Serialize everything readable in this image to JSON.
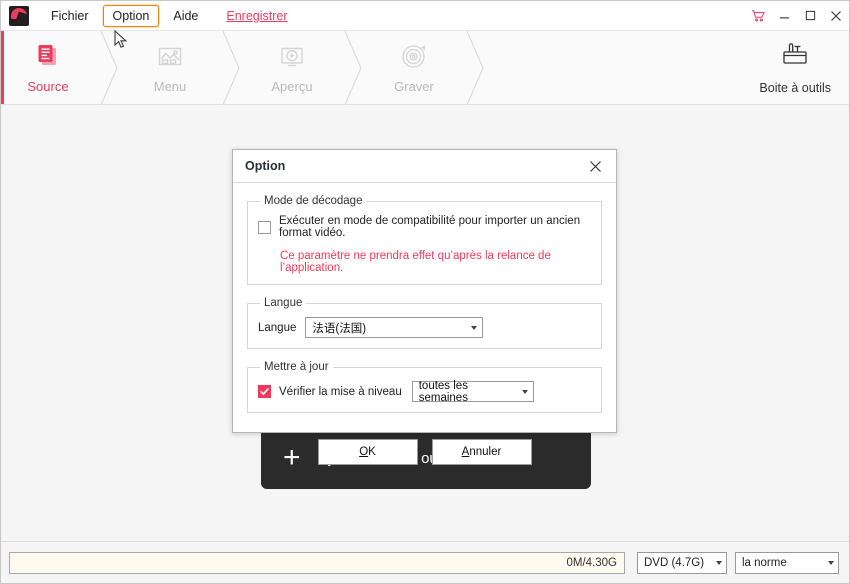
{
  "window": {
    "logo_icon": "app-logo-icon",
    "menus": [
      {
        "label": "Fichier",
        "highlighted": false
      },
      {
        "label": "Option",
        "highlighted": true
      },
      {
        "label": "Aide",
        "highlighted": false
      }
    ],
    "register_link": "Enregistrer",
    "controls": {
      "cart_icon": "shopping-cart-icon",
      "minimize_icon": "minimize-icon",
      "maximize_icon": "maximize-icon",
      "close_icon": "close-icon"
    }
  },
  "steps": {
    "accent_color": "#ee3a5c",
    "items": [
      {
        "label": "Source",
        "icon": "source-document-icon",
        "active": true
      },
      {
        "label": "Menu",
        "icon": "menu-image-icon",
        "active": false
      },
      {
        "label": "Aperçu",
        "icon": "preview-play-icon",
        "active": false
      },
      {
        "label": "Graver",
        "icon": "burn-disc-icon",
        "active": false
      }
    ],
    "toolbox": {
      "label": "Boite à outils",
      "icon": "toolbox-icon"
    }
  },
  "main": {
    "add_media": {
      "label": "Ajouter Photos ou Vidéos",
      "plus_icon": "plus-icon"
    }
  },
  "dialog": {
    "title": "Option",
    "close_icon": "close-icon",
    "decoding": {
      "legend": "Mode de décodage",
      "checkbox_label": "Exécuter en mode de compatibilité pour importer un ancien format vidéo.",
      "checked": false,
      "note": "Ce paramètre ne prendra effet qu’après la relance de l’application.",
      "note_color": "#ee3a5c"
    },
    "language": {
      "legend": "Langue",
      "field_label": "Langue",
      "value": "法语(法国)",
      "arrow_icon": "chevron-down-icon"
    },
    "update": {
      "legend": "Mettre à jour",
      "checkbox_label": "Vérifier la mise à niveau",
      "checked": true,
      "check_color": "#ee3a5c",
      "frequency_value": "toutes les semaines",
      "arrow_icon": "chevron-down-icon"
    },
    "buttons": {
      "ok_prefix": "",
      "ok_mnemonic": "O",
      "ok_suffix": "K",
      "cancel_mnemonic": "A",
      "cancel_suffix": "nnuler"
    }
  },
  "statusbar": {
    "progress_text": "0M/4.30G",
    "disc_type": "DVD (4.7G)",
    "quality": "la norme",
    "arrow_icon": "chevron-down-icon"
  }
}
